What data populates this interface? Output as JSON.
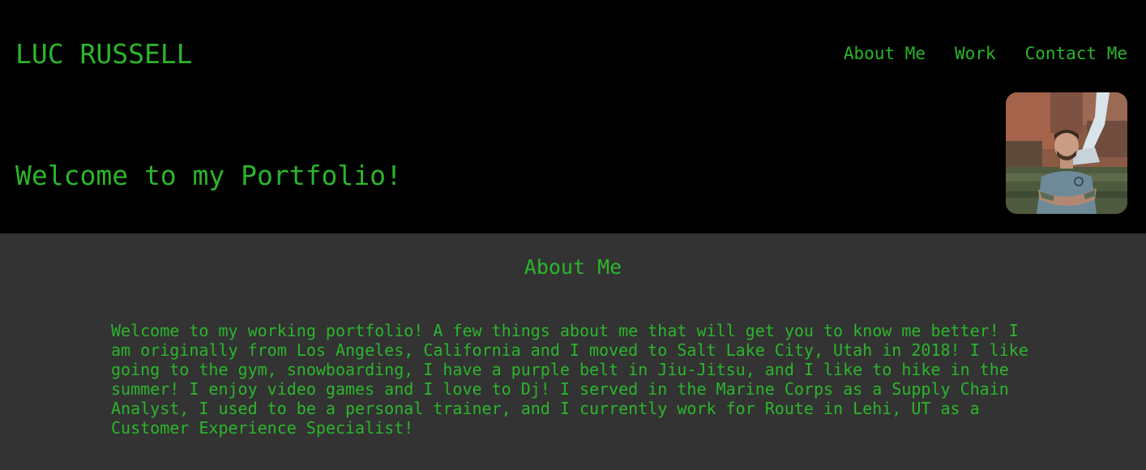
{
  "header": {
    "site_name": "LUC RUSSELL",
    "welcome": "Welcome to my Portfolio!"
  },
  "nav": {
    "items": [
      "About Me",
      "Work",
      "Contact Me"
    ]
  },
  "avatar": {
    "icon": "profile-photo"
  },
  "about": {
    "title": "About Me",
    "body": "Welcome to my working portfolio! A few things about me that will get you to know me better! I am originally from Los Angeles, California and I moved to Salt Lake City, Utah in 2018! I like going to the gym, snowboarding, I have a purple belt in Jiu-Jitsu, and I like to hike in the summer! I enjoy video games and I love to Dj! I served in the Marine Corps as a Supply Chain Analyst, I used to be a personal trainer, and I currently work for Route in Lehi, UT as a Customer Experience Specialist!"
  },
  "colors": {
    "accent": "#2bb52b",
    "header_bg": "#000000",
    "section_bg": "#333333"
  }
}
